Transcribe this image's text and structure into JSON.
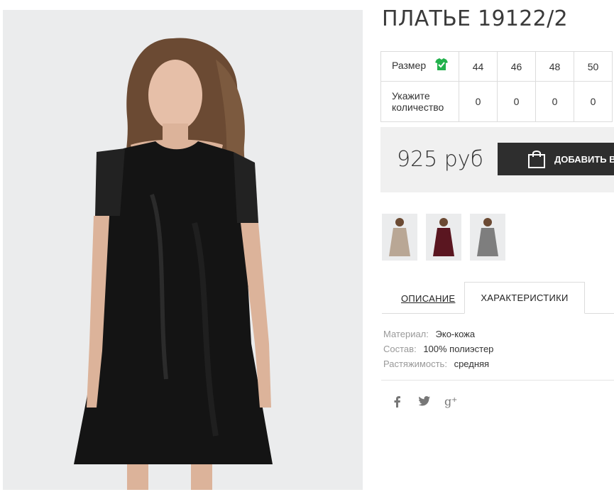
{
  "product": {
    "title": "ПЛАТЬЕ 19122/2",
    "price": "925 руб",
    "add_to_cart_label": "ДОБАВИТЬ В"
  },
  "size_table": {
    "size_label": "Размер",
    "quantity_label_line1": "Укажите",
    "quantity_label_line2": "количество",
    "sizes": [
      "44",
      "46",
      "48",
      "50"
    ],
    "quantities": [
      "0",
      "0",
      "0",
      "0"
    ]
  },
  "tabs": {
    "description": "ОПИСАНИЕ",
    "characteristics": "ХАРАКТЕРИСТИКИ"
  },
  "characteristics": [
    {
      "key": "Материал:",
      "value": "Эко-кожа"
    },
    {
      "key": "Состав:",
      "value": "100% полиэстер"
    },
    {
      "key": "Растяжимость:",
      "value": "средняя"
    }
  ],
  "thumbnails": [
    {
      "name": "beige dress",
      "color": "#b9a795"
    },
    {
      "name": "burgundy dress",
      "color": "#5a1620"
    },
    {
      "name": "grey dress",
      "color": "#7e7e7e"
    }
  ],
  "social_icons": [
    "facebook-icon",
    "twitter-icon",
    "google-plus-icon"
  ],
  "colors": {
    "button_bg": "#2e2e2e",
    "price_bg": "#f0f0f0",
    "check_icon": "#22b14c",
    "dress": "#141414"
  }
}
